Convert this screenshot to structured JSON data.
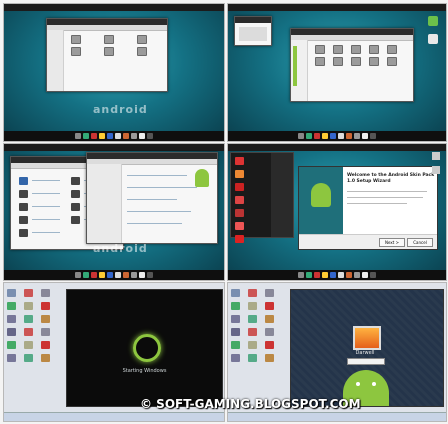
{
  "panels": [
    {
      "id": "p1",
      "name": "explorer-computer",
      "wallpaper_text": "android"
    },
    {
      "id": "p2",
      "name": "explorer-control-panel",
      "wallpaper_text": ""
    },
    {
      "id": "p3",
      "name": "control-panel-and-system",
      "wallpaper_text": "android"
    },
    {
      "id": "p4",
      "name": "start-menu-and-setup-wizard",
      "wallpaper_text": ""
    },
    {
      "id": "p5",
      "name": "boot-screen",
      "boot_text": "Starting Windows"
    },
    {
      "id": "p6",
      "name": "logon-screen",
      "user_name": "Darwell"
    }
  ],
  "setup_dialog": {
    "title_line1": "Welcome to the Android Skin Pack",
    "title_line2": "1.0 Setup Wizard",
    "next_label": "Next >",
    "cancel_label": "Cancel"
  },
  "watermark": "© SOFT-GAMING.BLOGSPOT.COM",
  "colors": {
    "accent": "#8dc63f",
    "teal": "#147184",
    "taskbar": "#0f0f0f"
  }
}
